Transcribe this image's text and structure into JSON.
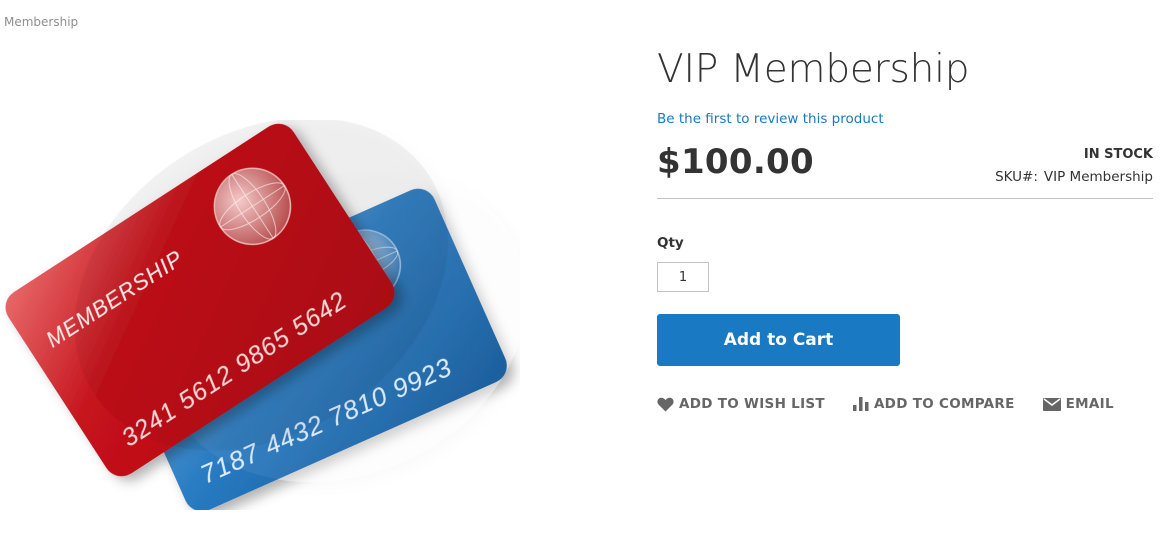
{
  "breadcrumb": {
    "current": "Membership"
  },
  "product": {
    "title": "VIP Membership",
    "review_link": "Be the first to review this product",
    "price": "$100.00",
    "stock": "IN STOCK",
    "sku_label": "SKU#:",
    "sku_value": "VIP Membership",
    "image": {
      "front_card_text": "MEMBERSHIP",
      "front_card_number": "3241 5612 9865 5642",
      "back_card_number": "7187 4432 7810 9923"
    }
  },
  "form": {
    "qty_label": "Qty",
    "qty_value": "1",
    "add_to_cart_label": "Add to Cart"
  },
  "actions": {
    "wishlist_label": "ADD TO WISH LIST",
    "compare_label": "ADD TO COMPARE",
    "email_label": "EMAIL"
  },
  "colors": {
    "accent": "#1979c3",
    "text": "#333333",
    "muted": "#666666",
    "red_card": "#c8101a",
    "blue_card": "#1f6fb5"
  },
  "icons": [
    "heart-icon",
    "bar-chart-icon",
    "envelope-icon",
    "globe-icon"
  ]
}
